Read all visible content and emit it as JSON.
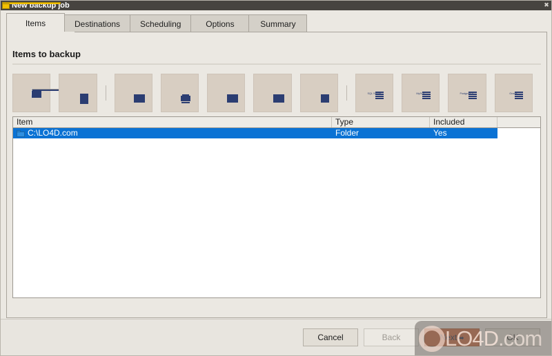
{
  "window": {
    "title": "New backup job",
    "icon": "folder-icon",
    "close_label": "✖"
  },
  "tabs": [
    {
      "label": "Items",
      "active": true
    },
    {
      "label": "Destinations",
      "active": false
    },
    {
      "label": "Scheduling",
      "active": false
    },
    {
      "label": "Options",
      "active": false
    },
    {
      "label": "Summary",
      "active": false
    }
  ],
  "section": {
    "title": "Items to backup"
  },
  "toolbar": {
    "buttons": [
      {
        "name": "add-folder-button",
        "icon": "folder-search-icon",
        "caption": ""
      },
      {
        "name": "add-file-button",
        "icon": "file-add-icon",
        "caption": ""
      },
      {
        "sep": true
      },
      {
        "name": "add-outlook-button",
        "icon": "outlook-icon",
        "caption": ""
      },
      {
        "name": "add-application-button",
        "icon": "application-icon",
        "caption": ""
      },
      {
        "name": "add-registry-button",
        "icon": "registry-icon",
        "caption": ""
      },
      {
        "name": "add-database-button",
        "icon": "database-list-icon",
        "caption": ""
      },
      {
        "name": "add-exchange-button",
        "icon": "exchange-icon",
        "caption": ""
      },
      {
        "sep": true
      },
      {
        "name": "add-sqlserver-button",
        "icon": "server-stack-icon",
        "caption": "SQL Server"
      },
      {
        "name": "add-mysql-button",
        "icon": "server-stack-icon",
        "caption": "MySQL"
      },
      {
        "name": "add-postgresql-button",
        "icon": "server-stack-icon",
        "caption": "PostgreSQL"
      },
      {
        "name": "add-oracle-button",
        "icon": "server-stack-icon",
        "caption": "Oracle"
      }
    ]
  },
  "list": {
    "columns": [
      "Item",
      "Type",
      "Included",
      ""
    ],
    "rows": [
      {
        "item": "C:\\LO4D.com",
        "type": "Folder",
        "included": "Yes",
        "selected": true,
        "icon": "folder-icon"
      }
    ]
  },
  "footer": {
    "cancel_label": "Cancel",
    "back_label": "Back",
    "next_label": "Next",
    "next_arrow": "➡",
    "ok_label": "OK"
  },
  "watermark": {
    "text_primary": "LO4D",
    "text_secondary": ".com",
    "logo": "refresh-circle-icon"
  },
  "colors": {
    "titlebar": "#474440",
    "dialog": "#ebe8e2",
    "tab_inactive": "#d4d0c8",
    "toolbar_button": "#d8cec2",
    "icon_blue": "#2b3d72",
    "selection_blue": "#0a72d4",
    "primary_button": "#c96b43",
    "title_icon_yellow": "#f2c003"
  }
}
